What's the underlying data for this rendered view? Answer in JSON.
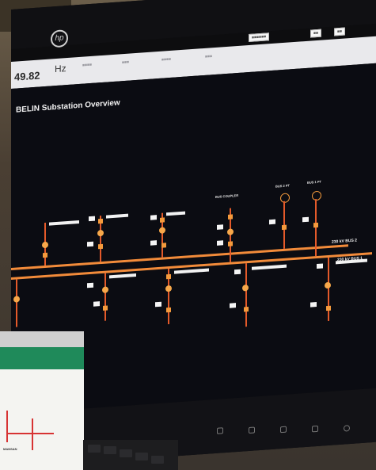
{
  "app": {
    "title": "BELIN Substation Overview",
    "frequency_value": "49.82",
    "frequency_unit": "Hz",
    "brand_logo_text": "hp"
  },
  "buses": {
    "bus2_label": "230 kV BUS 2",
    "bus1_label": "230 kV BUS 1"
  },
  "bays": {
    "bus_coupler_label": "BUS COUPLER",
    "bus2_pt_label": "BUS 2 PT",
    "bus1_pt_label": "BUS 1 PT"
  },
  "paper": {
    "caption": "MANSAN"
  },
  "colors": {
    "bus": "#f28b3a",
    "feeder": "#e45a2a",
    "breaker": "#f7a84a",
    "screen_background": "#0b0c12"
  }
}
